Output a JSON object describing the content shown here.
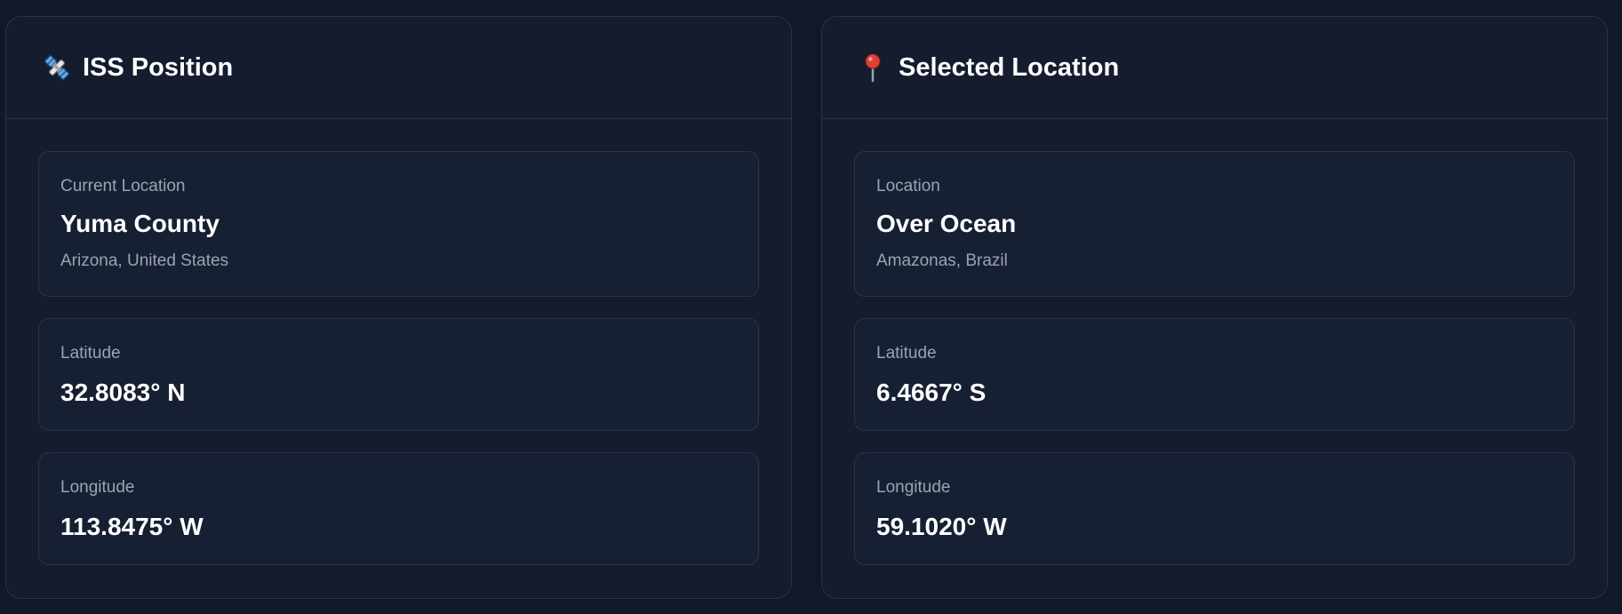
{
  "iss": {
    "title": "ISS Position",
    "icon": "satellite-icon",
    "location_label": "Current Location",
    "location_name": "Yuma County",
    "location_region": "Arizona, United States",
    "latitude_label": "Latitude",
    "latitude_value": "32.8083° N",
    "longitude_label": "Longitude",
    "longitude_value": "113.8475° W"
  },
  "selected": {
    "title": "Selected Location",
    "icon": "pushpin-icon",
    "location_label": "Location",
    "location_name": "Over Ocean",
    "location_region": "Amazonas, Brazil",
    "latitude_label": "Latitude",
    "latitude_value": "6.4667° S",
    "longitude_label": "Longitude",
    "longitude_value": "59.1020° W"
  },
  "colors": {
    "page_bg": "#111827",
    "panel_bg": "#141c2e",
    "card_bg": "#172033",
    "border": "#2a3447",
    "muted_text": "#9aa3b2",
    "primary_text": "#ffffff"
  }
}
